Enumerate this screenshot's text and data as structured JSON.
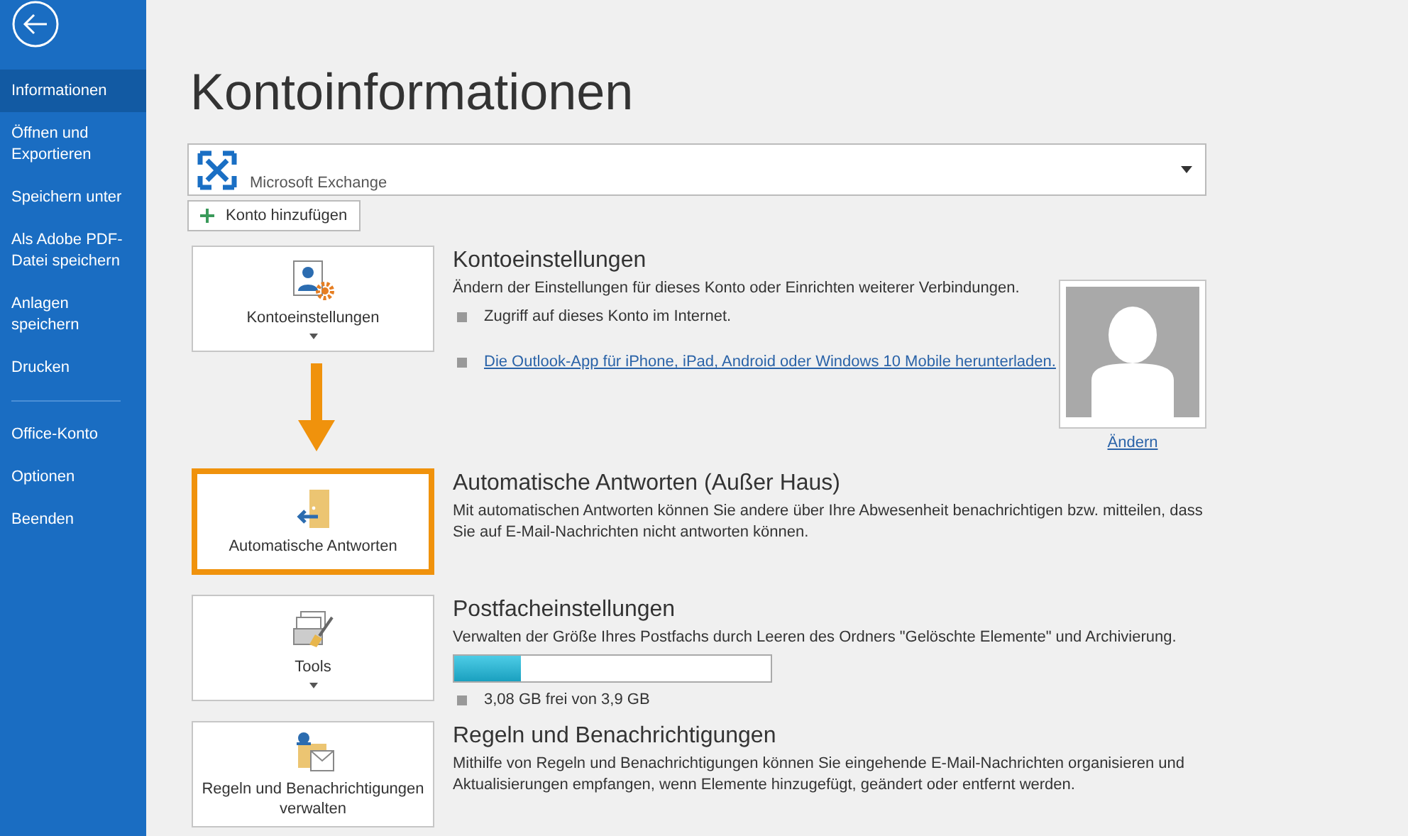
{
  "sidebar": {
    "items": [
      {
        "label": "Informationen",
        "selected": true,
        "divider_after": false
      },
      {
        "label": "Öffnen und Exportieren",
        "selected": false,
        "divider_after": false
      },
      {
        "label": "Speichern unter",
        "selected": false,
        "divider_after": false
      },
      {
        "label": "Als Adobe PDF-Datei speichern",
        "selected": false,
        "divider_after": false
      },
      {
        "label": "Anlagen speichern",
        "selected": false,
        "divider_after": false
      },
      {
        "label": "Drucken",
        "selected": false,
        "divider_after": true
      },
      {
        "label": "Office-Konto",
        "selected": false,
        "divider_after": false
      },
      {
        "label": "Optionen",
        "selected": false,
        "divider_after": false
      },
      {
        "label": "Beenden",
        "selected": false,
        "divider_after": false
      }
    ]
  },
  "page_title": "Kontoinformationen",
  "account_select": {
    "value": "Microsoft Exchange"
  },
  "add_account_button": "Konto hinzufügen",
  "sections": [
    {
      "kind": "account",
      "button": {
        "label": "Kontoeinstellungen",
        "caret": true
      },
      "highlighted": false,
      "arrow_after": true,
      "title": "Kontoeinstellungen",
      "description": "Ändern der Einstellungen für dieses Konto oder Einrichten weiterer Verbindungen.",
      "bullets": [
        {
          "kind": "text",
          "text": "Zugriff auf dieses Konto im Internet."
        },
        {
          "kind": "link",
          "text": "Die Outlook-App für iPhone, iPad, Android oder Windows 10 Mobile herunterladen."
        }
      ],
      "avatar": {
        "link": "Ändern"
      }
    },
    {
      "kind": "auto-reply",
      "button": {
        "label": "Automatische Antworten",
        "caret": false
      },
      "highlighted": true,
      "arrow_after": false,
      "title": "Automatische Antworten (Außer Haus)",
      "description": "Mit automatischen Antworten können Sie andere über Ihre Abwesenheit benachrichtigen bzw. mitteilen, dass Sie auf E-Mail-Nachrichten nicht antworten können."
    },
    {
      "kind": "tools",
      "button": {
        "label": "Tools",
        "caret": true
      },
      "highlighted": false,
      "arrow_after": false,
      "title": "Postfacheinstellungen",
      "description": "Verwalten der Größe Ihres Postfachs durch Leeren des Ordners \"Gelöschte Elemente\" und Archivierung.",
      "progress": {
        "level": 0.21
      },
      "bullets": [
        {
          "kind": "text",
          "text": "3,08 GB frei von 3,9 GB"
        }
      ]
    },
    {
      "kind": "rules",
      "button": {
        "label": "Regeln und Benachrichtigungen verwalten",
        "caret": false
      },
      "highlighted": false,
      "arrow_after": false,
      "title": "Regeln und Benachrichtigungen",
      "description": "Mithilfe von Regeln und Benachrichtigungen können Sie eingehende E-Mail-Nachrichten organisieren und Aktualisierungen empfangen, wenn Elemente hinzugefügt, geändert oder entfernt werden."
    }
  ]
}
